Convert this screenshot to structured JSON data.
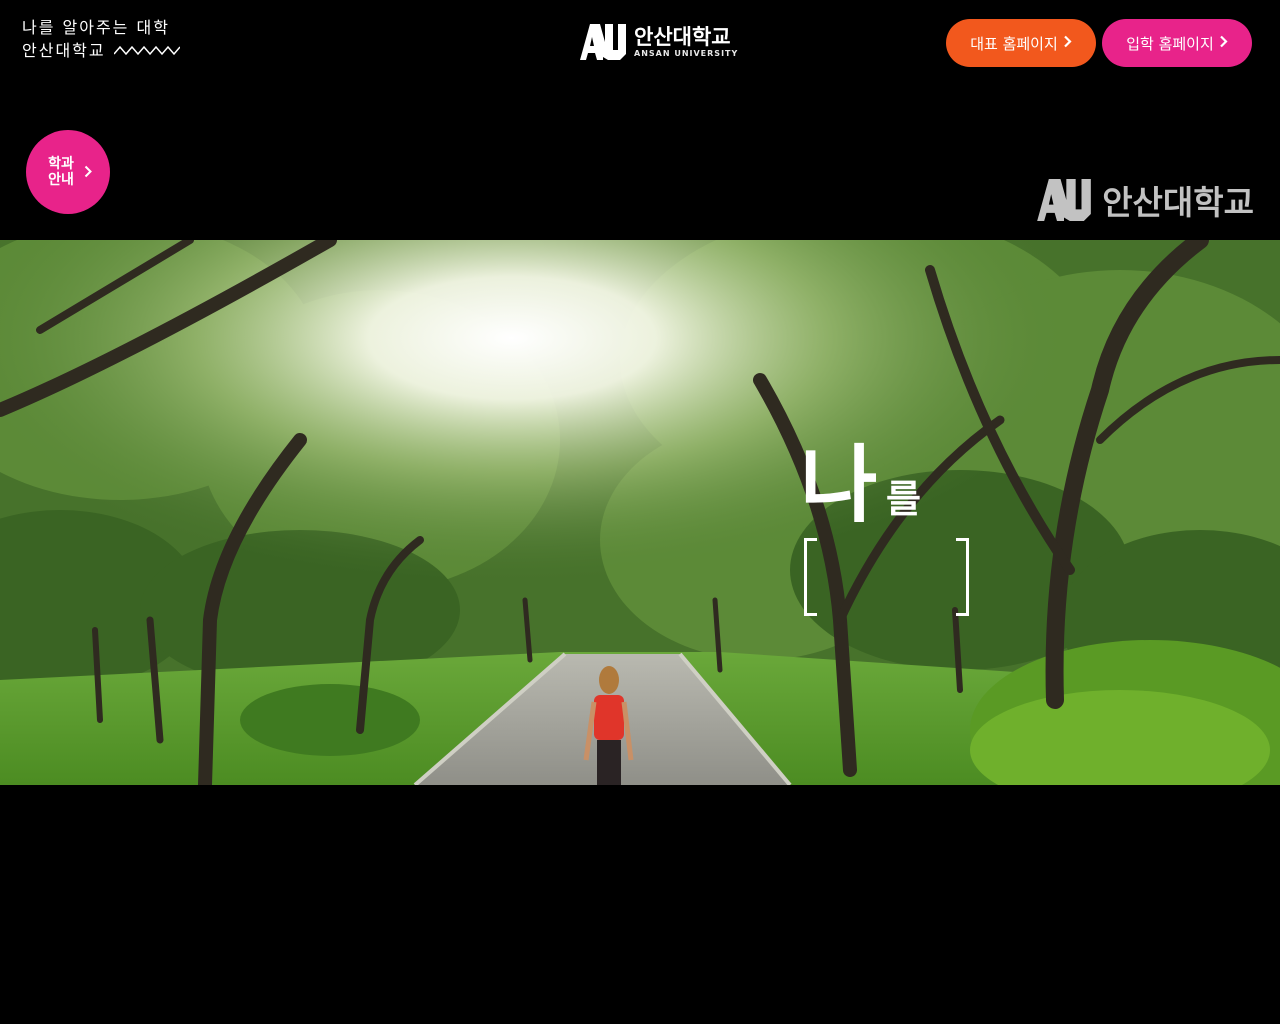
{
  "header": {
    "slogan_line1": "나를 알아주는 대학",
    "slogan_line2": "안산대학교",
    "logo_mark": "AU",
    "logo_korean": "안산대학교",
    "logo_english": "ANSAN UNIVERSITY",
    "buttons": [
      {
        "label": "대표 홈페이지",
        "color": "#f2581d",
        "icon": "chevron-right-icon"
      },
      {
        "label": "입학 홈페이지",
        "color": "#e8238a",
        "icon": "chevron-right-icon"
      }
    ]
  },
  "dept_button": {
    "label_line1": "학과",
    "label_line2": "안내",
    "color": "#e8238a",
    "icon": "chevron-right-icon"
  },
  "video": {
    "watermark_mark": "AU",
    "watermark_text": "안산대학교",
    "caption_big": "나",
    "caption_small": "를"
  }
}
